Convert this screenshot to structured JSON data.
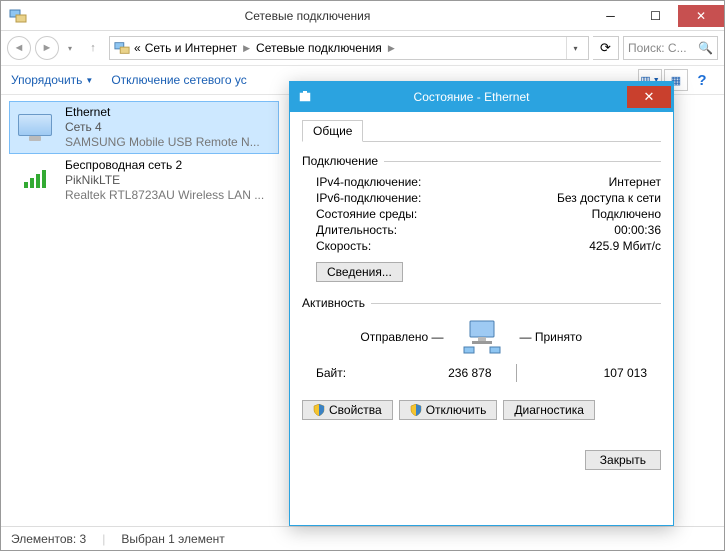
{
  "window": {
    "title": "Сетевые подключения"
  },
  "nav": {
    "crumb_prefix": "«",
    "crumb1": "Сеть и Интернет",
    "crumb2": "Сетевые подключения",
    "search_placeholder": "Поиск: С..."
  },
  "toolbar": {
    "organize": "Упорядочить",
    "disable": "Отключение сетевого ус"
  },
  "connections": [
    {
      "name": "Ethernet",
      "network": "Сеть 4",
      "device": "SAMSUNG Mobile USB Remote N..."
    },
    {
      "name": "Беспроводная сеть 2",
      "network": "PikNikLTE",
      "device": "Realtek RTL8723AU Wireless LAN ..."
    }
  ],
  "status": {
    "count_label": "Элементов: 3",
    "selection_label": "Выбран 1 элемент"
  },
  "dialog": {
    "title": "Состояние - Ethernet",
    "tab": "Общие",
    "section_connection": "Подключение",
    "ipv4_label": "IPv4-подключение:",
    "ipv4_value": "Интернет",
    "ipv6_label": "IPv6-подключение:",
    "ipv6_value": "Без доступа к сети",
    "media_label": "Состояние среды:",
    "media_value": "Подключено",
    "duration_label": "Длительность:",
    "duration_value": "00:00:36",
    "speed_label": "Скорость:",
    "speed_value": "425.9 Мбит/с",
    "details_btn": "Сведения...",
    "section_activity": "Активность",
    "sent_label": "Отправлено",
    "recv_label": "Принято",
    "bytes_label": "Байт:",
    "bytes_sent": "236 878",
    "bytes_recv": "107 013",
    "properties_btn": "Свойства",
    "disable_btn": "Отключить",
    "diagnose_btn": "Диагностика",
    "close_btn": "Закрыть"
  }
}
